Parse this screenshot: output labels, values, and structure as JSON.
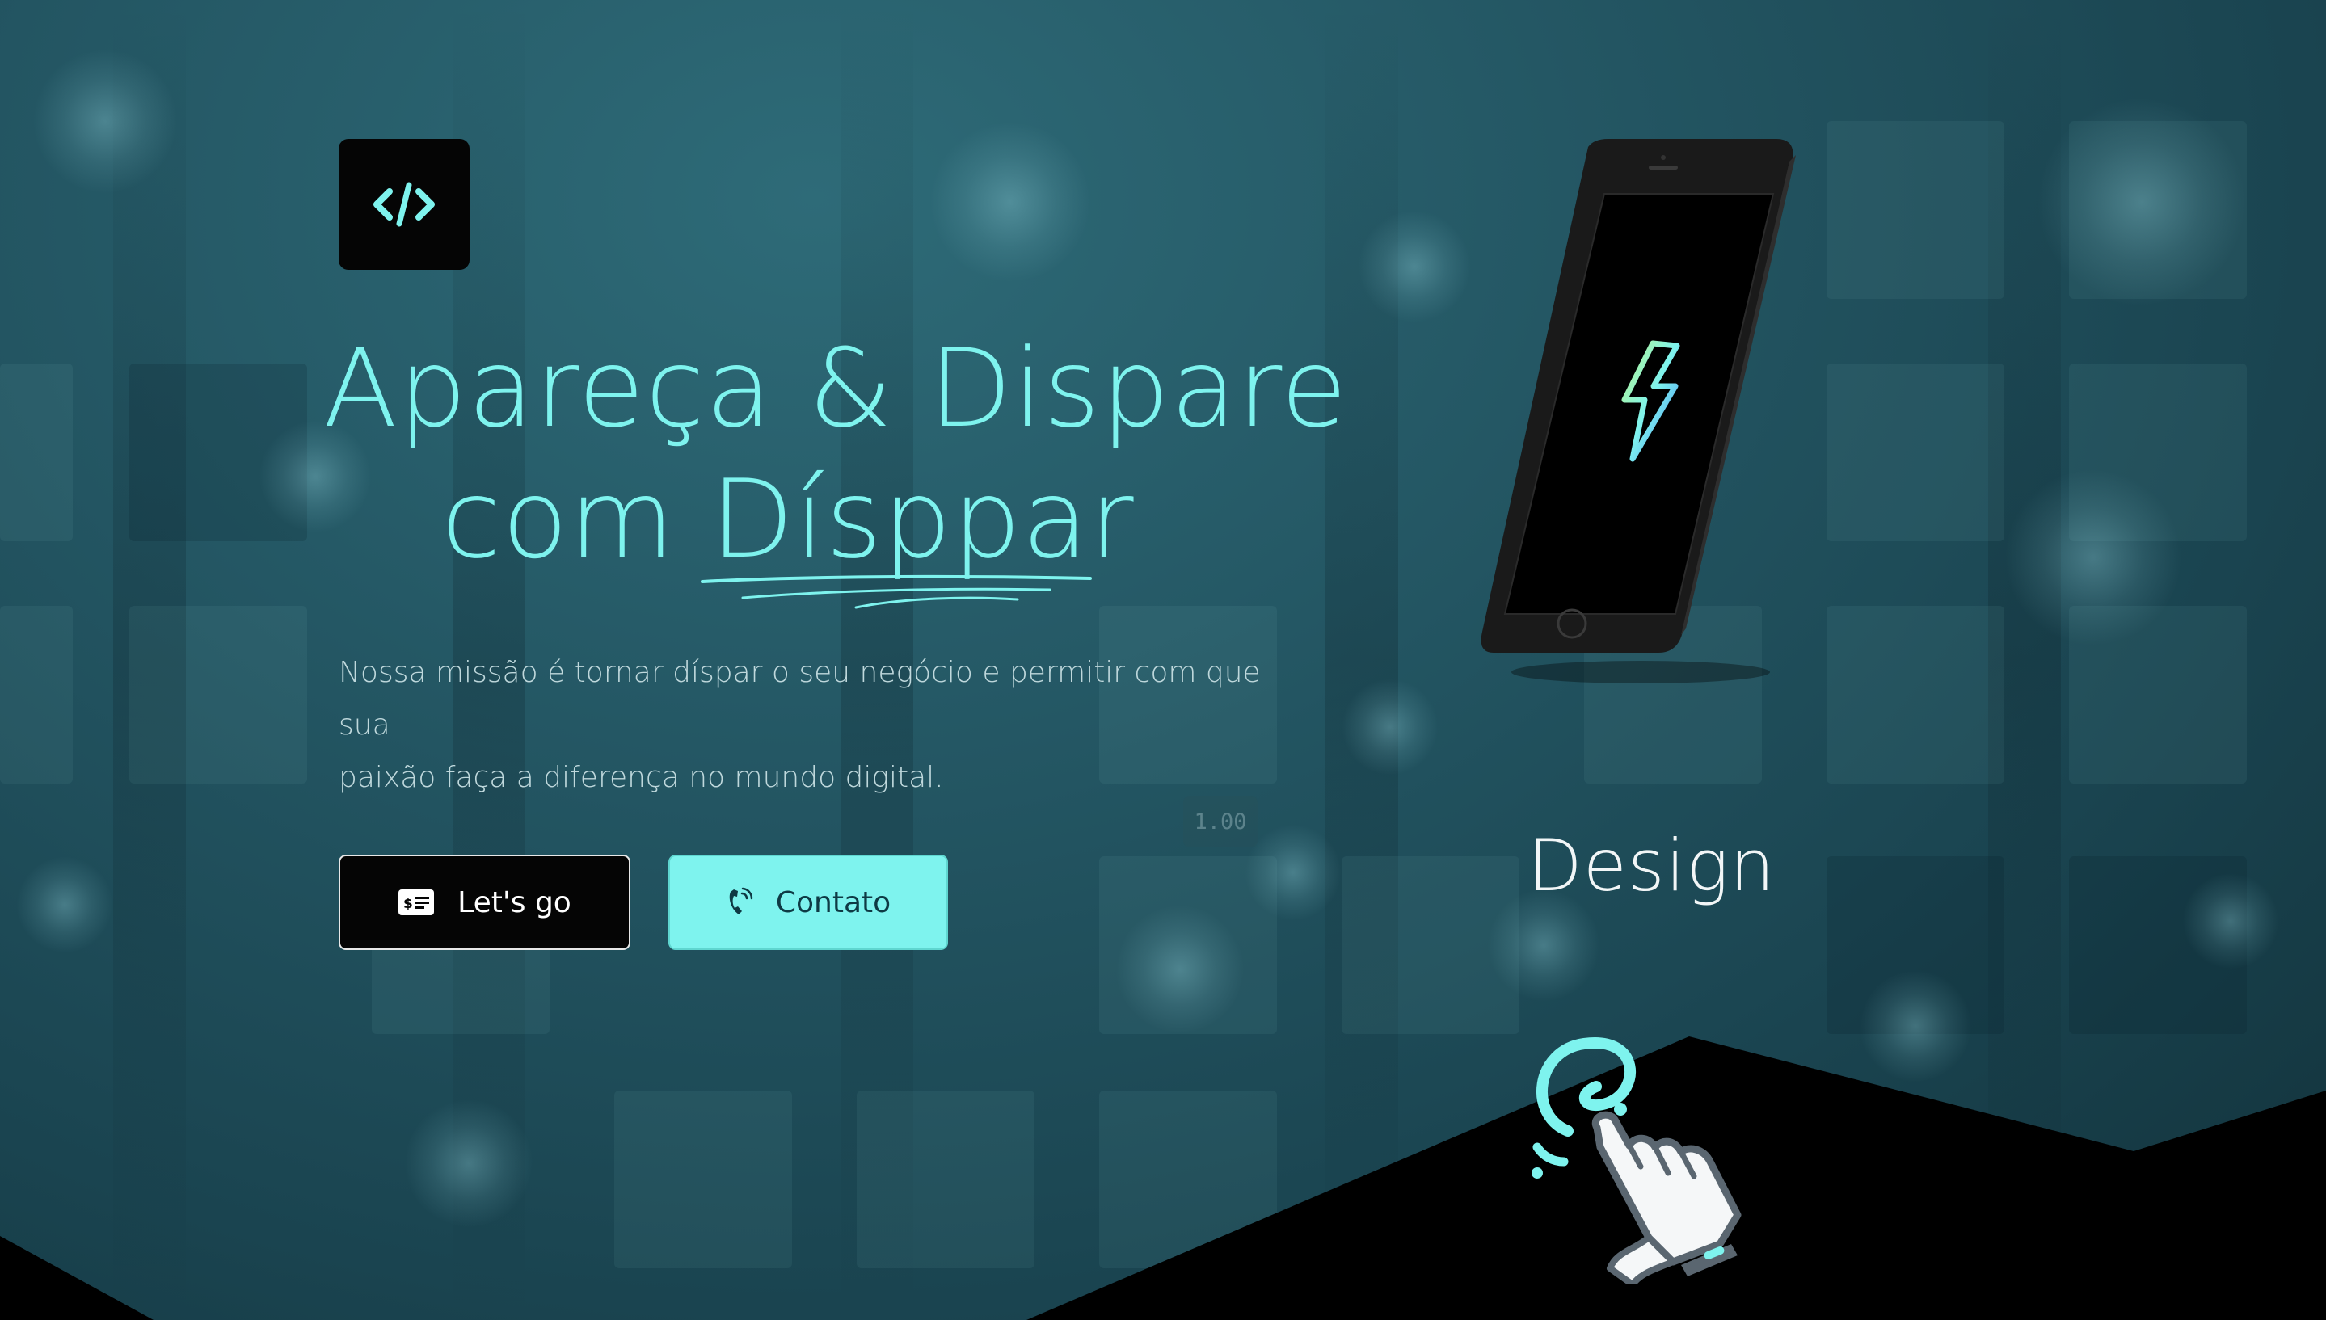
{
  "hero": {
    "headline_line1": "Apareça & Dispare",
    "headline_prefix": "com ",
    "headline_brand": "Dísppar",
    "subtitle_line1": "Nossa missão é tornar díspar o seu negócio e permitir com que sua",
    "subtitle_line2": "paixão faça a diferença no mundo digital."
  },
  "buttons": {
    "lets_go": {
      "label": "Let's go",
      "icon": "id-card-icon"
    },
    "contact": {
      "label": "Contato",
      "icon": "phone-ringing-icon"
    }
  },
  "logo": {
    "icon": "code-icon"
  },
  "zoom_indicator": "1.00",
  "feature": {
    "label": "Design",
    "phone_icon": "lightning-bolt-icon",
    "illustration_icon": "pointing-hand-icon"
  },
  "colors": {
    "accent": "#7ef3ee",
    "dark": "#050505",
    "background": "#245764"
  }
}
